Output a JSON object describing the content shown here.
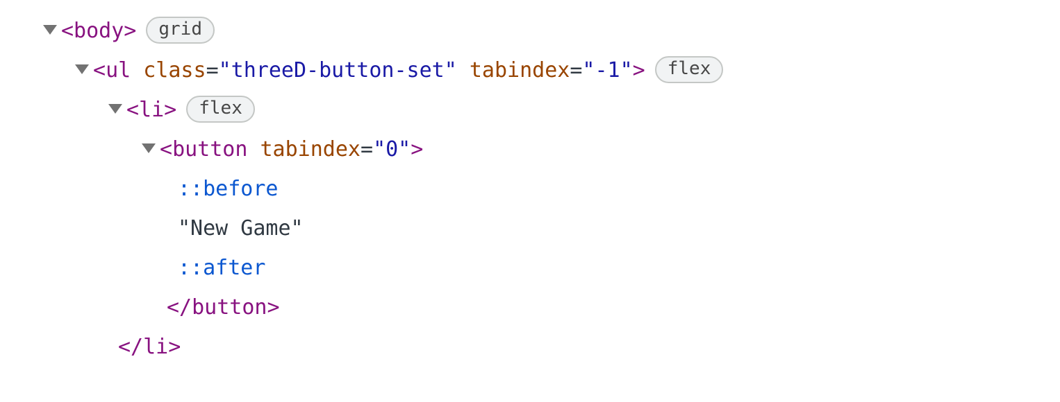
{
  "tree": {
    "node0": {
      "open": "<body>",
      "badge": "grid"
    },
    "node1": {
      "tag": "ul",
      "attr1_name": "class",
      "attr1_value": "\"threeD-button-set\"",
      "attr2_name": "tabindex",
      "attr2_value": "\"-1\"",
      "badge": "flex"
    },
    "node2": {
      "open": "<li>",
      "badge": "flex"
    },
    "node3": {
      "tag": "button",
      "attr1_name": "tabindex",
      "attr1_value": "\"0\""
    },
    "pseudo_before": "::before",
    "text_node": "\"New Game\"",
    "pseudo_after": "::after",
    "close_button": "</button>",
    "close_li": "</li>"
  }
}
